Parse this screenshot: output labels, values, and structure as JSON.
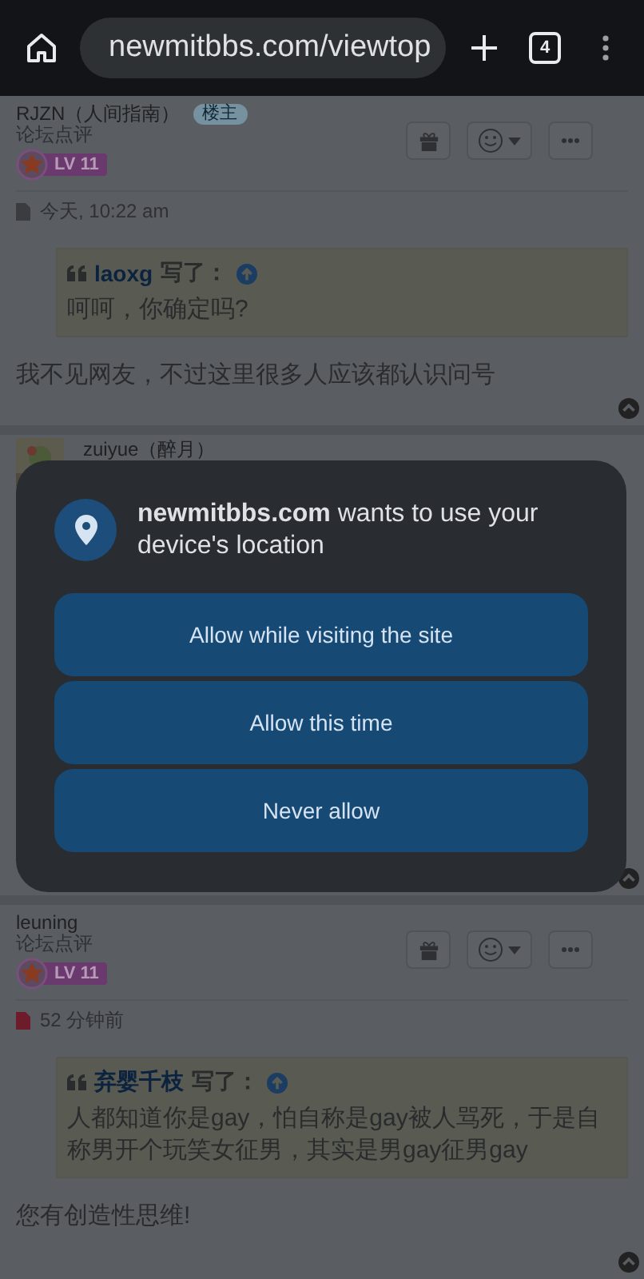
{
  "browser": {
    "url": "newmitbbs.com/viewtop",
    "tab_count": "4"
  },
  "posts": [
    {
      "kind": "full",
      "author": "RJZN（人间指南）",
      "owner_tag": "楼主",
      "subtitle": "论坛点评",
      "level": "LV 11",
      "date": "今天, 10:22 am",
      "color": "#3a3c3f",
      "quote": {
        "author": "laoxg",
        "label": "写了：",
        "text": "呵呵，你确定吗?"
      },
      "body": "我不见网友，不过这里很多人应该都认识问号"
    },
    {
      "kind": "covered",
      "author": "zuiyue（醉月）"
    },
    {
      "kind": "full",
      "author": "leuning",
      "subtitle": "论坛点评",
      "level": "LV 11",
      "date": "52 分钟前",
      "color": "#6e1b2c",
      "quote": {
        "author": "弃婴千枝",
        "label": "写了：",
        "text": "人都知道你是gay，怕自称是gay被人骂死，于是自称男开个玩笑女征男，其实是男gay征男gay"
      },
      "body": "您有创造性思维!"
    }
  ],
  "dialog": {
    "message": "**newmitbbs.com** wants to use your device's location",
    "buttons": [
      "Allow while visiting the site",
      "Allow this time",
      "Never allow"
    ]
  }
}
